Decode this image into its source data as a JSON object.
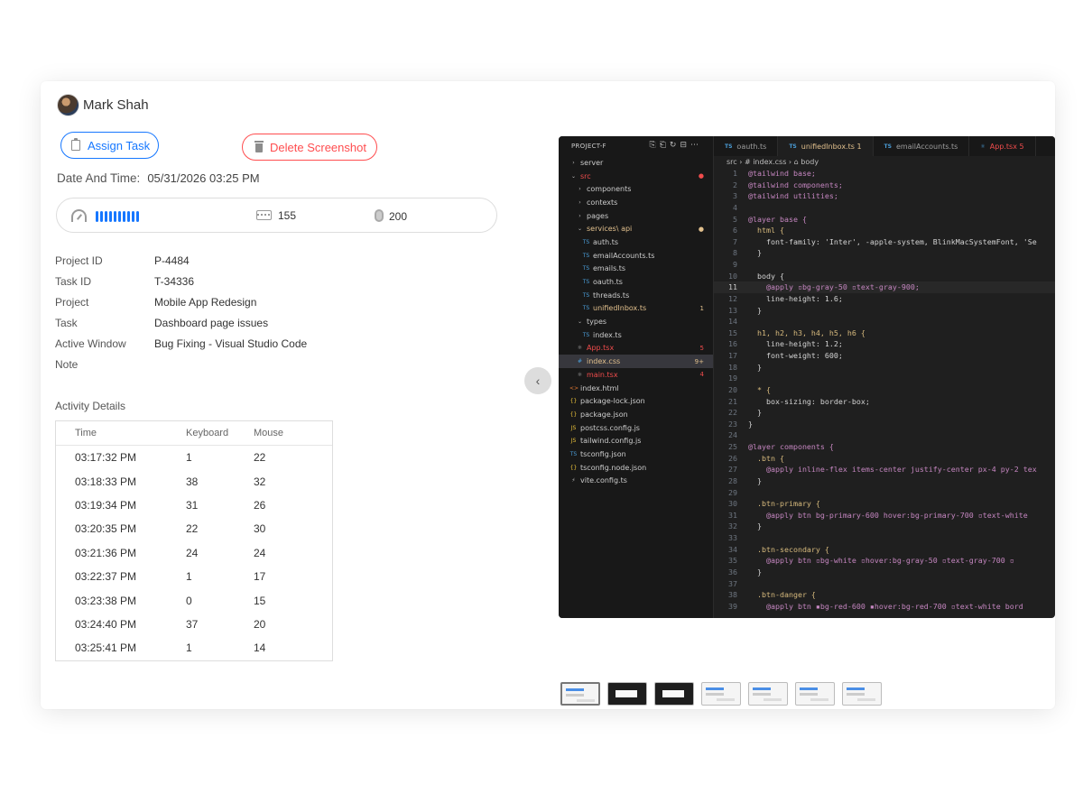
{
  "user": {
    "name": "Mark Shah"
  },
  "actions": {
    "assign_label": "Assign Task",
    "delete_label": "Delete Screenshot"
  },
  "datetime": {
    "label": "Date And Time:",
    "value": "05/31/2026 03:25 PM"
  },
  "stats": {
    "activity_level": 10,
    "keyboard": "155",
    "mouse": "200"
  },
  "details": [
    {
      "key": "Project ID",
      "value": "P-4484"
    },
    {
      "key": "Task ID",
      "value": "T-34336"
    },
    {
      "key": "Project",
      "value": "Mobile App Redesign"
    },
    {
      "key": "Task",
      "value": "Dashboard page issues"
    },
    {
      "key": "Active Window",
      "value": "Bug Fixing - Visual Studio Code"
    },
    {
      "key": "Note",
      "value": ""
    }
  ],
  "activity": {
    "title": "Activity Details",
    "headers": [
      "Time",
      "Keyboard",
      "Mouse"
    ],
    "rows": [
      [
        "03:17:32 PM",
        "1",
        "22"
      ],
      [
        "03:18:33 PM",
        "38",
        "32"
      ],
      [
        "03:19:34 PM",
        "31",
        "26"
      ],
      [
        "03:20:35 PM",
        "22",
        "30"
      ],
      [
        "03:21:36 PM",
        "24",
        "24"
      ],
      [
        "03:22:37 PM",
        "1",
        "17"
      ],
      [
        "03:23:38 PM",
        "0",
        "15"
      ],
      [
        "03:24:40 PM",
        "37",
        "20"
      ],
      [
        "03:25:41 PM",
        "1",
        "14"
      ]
    ]
  },
  "screenshot": {
    "explorer_title": "PROJECT-F",
    "tree": [
      {
        "label": "server",
        "ico": "›",
        "indent": 0,
        "color": "#cccccc",
        "badge": ""
      },
      {
        "label": "src",
        "ico": "⌄",
        "indent": 0,
        "color": "#f14c4c",
        "badge": "●"
      },
      {
        "label": "components",
        "ico": "›",
        "indent": 1,
        "color": "#cccccc",
        "badge": ""
      },
      {
        "label": "contexts",
        "ico": "›",
        "indent": 1,
        "color": "#cccccc",
        "badge": ""
      },
      {
        "label": "pages",
        "ico": "›",
        "indent": 1,
        "color": "#cccccc",
        "badge": ""
      },
      {
        "label": "services\\ api",
        "ico": "⌄",
        "indent": 1,
        "color": "#e2c08d",
        "badge": "●"
      },
      {
        "label": "auth.ts",
        "ico": "TS",
        "indent": 2,
        "color": "#cccccc",
        "badge": ""
      },
      {
        "label": "emailAccounts.ts",
        "ico": "TS",
        "indent": 2,
        "color": "#cccccc",
        "badge": ""
      },
      {
        "label": "emails.ts",
        "ico": "TS",
        "indent": 2,
        "color": "#cccccc",
        "badge": ""
      },
      {
        "label": "oauth.ts",
        "ico": "TS",
        "indent": 2,
        "color": "#cccccc",
        "badge": ""
      },
      {
        "label": "threads.ts",
        "ico": "TS",
        "indent": 2,
        "color": "#cccccc",
        "badge": ""
      },
      {
        "label": "unifiedInbox.ts",
        "ico": "TS",
        "indent": 2,
        "color": "#e2c08d",
        "badge": "1"
      },
      {
        "label": "types",
        "ico": "⌄",
        "indent": 1,
        "color": "#cccccc",
        "badge": ""
      },
      {
        "label": "index.ts",
        "ico": "TS",
        "indent": 2,
        "color": "#cccccc",
        "badge": ""
      },
      {
        "label": "App.tsx",
        "ico": "⚛",
        "indent": 1,
        "color": "#f14c4c",
        "badge": "5"
      },
      {
        "label": "index.css",
        "ico": "#",
        "indent": 1,
        "color": "#e2c08d",
        "badge": "9+",
        "sel": true
      },
      {
        "label": "main.tsx",
        "ico": "⚛",
        "indent": 1,
        "color": "#f14c4c",
        "badge": "4"
      },
      {
        "label": "index.html",
        "ico": "<>",
        "indent": 0,
        "color": "#cccccc",
        "badge": ""
      },
      {
        "label": "package-lock.json",
        "ico": "{}",
        "indent": 0,
        "color": "#cccccc",
        "badge": ""
      },
      {
        "label": "package.json",
        "ico": "{}",
        "indent": 0,
        "color": "#cccccc",
        "badge": ""
      },
      {
        "label": "postcss.config.js",
        "ico": "JS",
        "indent": 0,
        "color": "#cccccc",
        "badge": ""
      },
      {
        "label": "tailwind.config.js",
        "ico": "JS",
        "indent": 0,
        "color": "#cccccc",
        "badge": ""
      },
      {
        "label": "tsconfig.json",
        "ico": "TS",
        "indent": 0,
        "color": "#cccccc",
        "badge": ""
      },
      {
        "label": "tsconfig.node.json",
        "ico": "{}",
        "indent": 0,
        "color": "#cccccc",
        "badge": ""
      },
      {
        "label": "vite.config.ts",
        "ico": "⚡",
        "indent": 0,
        "color": "#cccccc",
        "badge": ""
      }
    ],
    "tabs": [
      {
        "label": "oauth.ts",
        "ico": "TS",
        "active": false
      },
      {
        "label": "unifiedInbox.ts 1",
        "ico": "TS",
        "active": true
      },
      {
        "label": "emailAccounts.ts",
        "ico": "TS",
        "active": false
      },
      {
        "label": "App.tsx  5",
        "ico": "⚛",
        "active": false
      }
    ],
    "breadcrumb": "src ›  #  index.css ›  ⌂ body",
    "current_line": 11,
    "code": [
      "@tailwind base;",
      "@tailwind components;",
      "@tailwind utilities;",
      "",
      "@layer base {",
      "  html {",
      "    font-family: 'Inter', -apple-system, BlinkMacSystemFont, 'Se",
      "  }",
      "",
      "  body {",
      "    @apply ▫bg-gray-50 ▫text-gray-900;",
      "    line-height: 1.6;",
      "  }",
      "",
      "  h1, h2, h3, h4, h5, h6 {",
      "    line-height: 1.2;",
      "    font-weight: 600;",
      "  }",
      "",
      "  * {",
      "    box-sizing: border-box;",
      "  }",
      "}",
      "",
      "@layer components {",
      "  .btn {",
      "    @apply inline-flex items-center justify-center px-4 py-2 tex",
      "  }",
      "",
      "  .btn-primary {",
      "    @apply btn bg-primary-600 hover:bg-primary-700 ▫text-white",
      "  }",
      "",
      "  .btn-secondary {",
      "    @apply btn ▫bg-white ▫hover:bg-gray-50 ▫text-gray-700 ▫",
      "  }",
      "",
      "  .btn-danger {",
      "    @apply btn ▪bg-red-600 ▪hover:bg-red-700 ▫text-white bord"
    ],
    "thumbnails": [
      "light",
      "dark",
      "dark",
      "light",
      "light",
      "light",
      "light"
    ]
  }
}
